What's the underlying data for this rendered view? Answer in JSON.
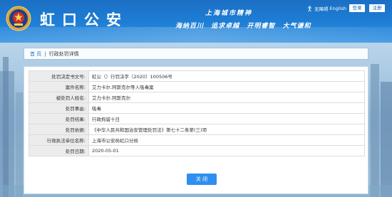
{
  "header": {
    "title": "虹口公安",
    "slogan_top": "上海城市精神",
    "slogan_bottom": [
      "海纳百川",
      "追求卓越",
      "开明睿智",
      "大气谦和"
    ],
    "accessibility_label": "无障碍",
    "english_label": "English",
    "login_label": "登录",
    "register_label": "注册"
  },
  "breadcrumb": {
    "home": "首 页",
    "separator": "|",
    "current": "行政处罚详情"
  },
  "detail": {
    "rows": [
      {
        "label": "处罚决定书文号:",
        "value": "虹公（）行罚决字〔2020〕100506号"
      },
      {
        "label": "案件名称:",
        "value": "艾力卡尔.阿斯克尔等人吸毒案"
      },
      {
        "label": "被处罚人姓名:",
        "value": "艾力卡尔.阿斯克尔"
      },
      {
        "label": "处罚事由:",
        "value": "吸毒"
      },
      {
        "label": "处罚结果:",
        "value": "行政拘留十日"
      },
      {
        "label": "处罚依据:",
        "value": "《中华人民共和国治安管理处罚法》第七十二条第(三)项"
      },
      {
        "label": "行政执法单位名称:",
        "value": "上海市公安局虹口分局"
      },
      {
        "label": "处罚日期:",
        "value": "2020-05-01"
      }
    ],
    "close_label": "关 闭"
  },
  "colors": {
    "header_blue": "#1e7fd6",
    "button_blue": "#2e8ff0",
    "link_blue": "#1f6fbf",
    "label_bg": "#ececec"
  },
  "icons": [
    "police-emblem-icon",
    "accessibility-icon"
  ]
}
